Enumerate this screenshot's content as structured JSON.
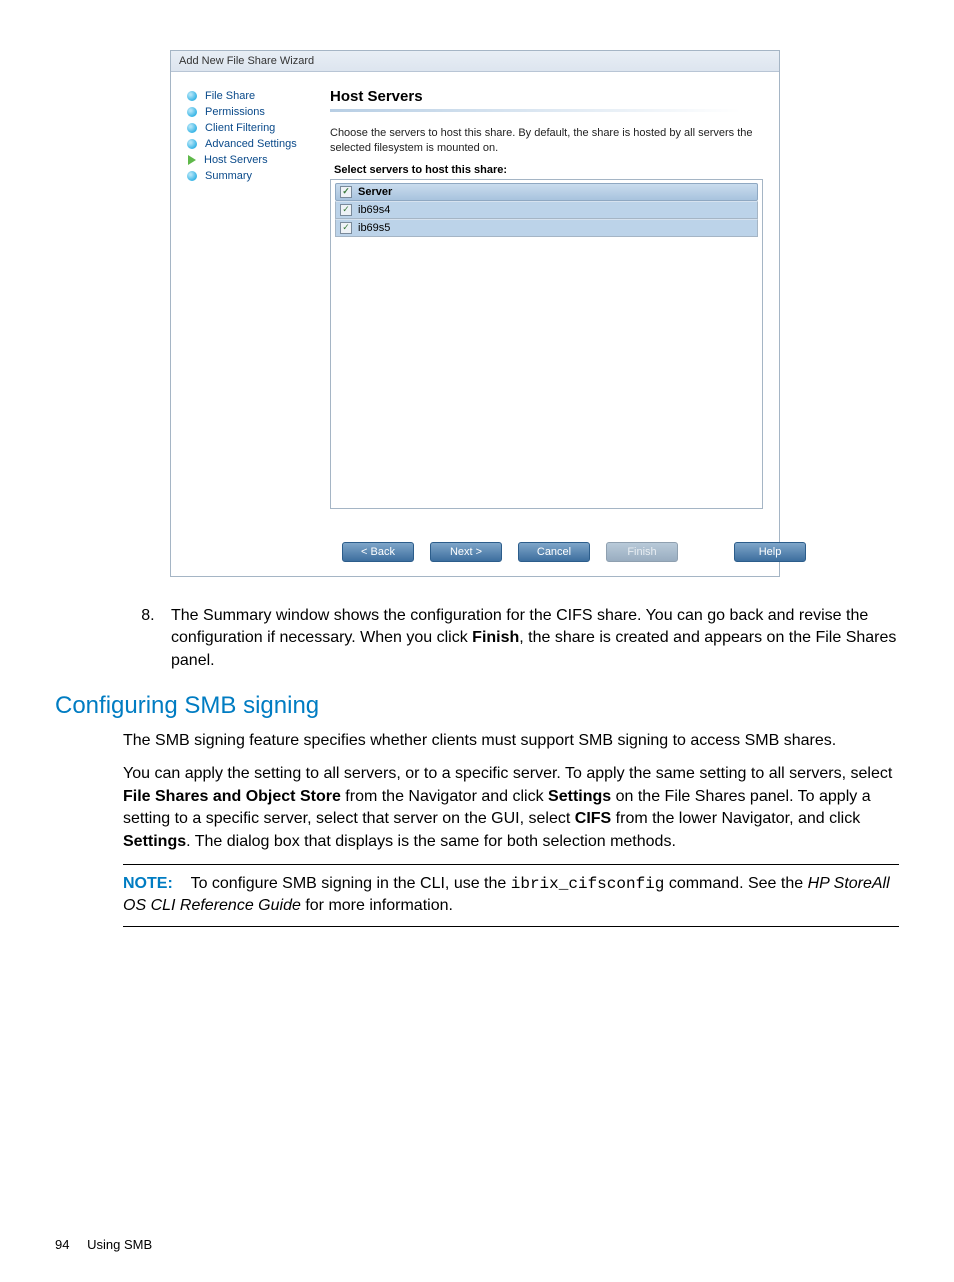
{
  "wizard": {
    "title": "Add New File Share Wizard",
    "nav": [
      {
        "label": "File Share",
        "current": false
      },
      {
        "label": "Permissions",
        "current": false
      },
      {
        "label": "Client Filtering",
        "current": false
      },
      {
        "label": "Advanced Settings",
        "current": false
      },
      {
        "label": "Host Servers",
        "current": true
      },
      {
        "label": "Summary",
        "current": false
      }
    ],
    "content": {
      "heading": "Host Servers",
      "description": "Choose the servers to host this share. By default, the share is hosted by all servers the selected filesystem is mounted on.",
      "select_label": "Select servers to host this share:",
      "server_header": "Server",
      "servers": [
        {
          "name": "ib69s4",
          "checked": true
        },
        {
          "name": "ib69s5",
          "checked": true
        }
      ]
    },
    "buttons": {
      "back": "< Back",
      "next": "Next >",
      "cancel": "Cancel",
      "finish": "Finish",
      "help": "Help"
    }
  },
  "doc": {
    "step8_pre": "The Summary window shows the configuration for the CIFS share. You can go back and revise the configuration if necessary. When you click ",
    "step8_bold": "Finish",
    "step8_post": ", the share is created and appears on the File Shares panel.",
    "section_heading": "Configuring SMB signing",
    "p1": "The SMB signing feature specifies whether clients must support SMB signing to access SMB shares.",
    "p2_a": "You can apply the setting to all servers, or to a specific server. To apply the same setting to all servers, select ",
    "p2_b1": "File Shares and Object Store",
    "p2_c": " from the Navigator and click ",
    "p2_b2": "Settings",
    "p2_d": " on the File Shares panel. To apply a setting to a specific server, select that server on the GUI, select ",
    "p2_b3": "CIFS",
    "p2_e": " from the lower Navigator, and click ",
    "p2_b4": "Settings",
    "p2_f": ". The dialog box that displays is the same for both selection methods.",
    "note_label": "NOTE:",
    "note_pre": "To configure SMB signing in the CLI, use the ",
    "note_cmd": "ibrix_cifsconfig",
    "note_mid": " command. See the ",
    "note_italic": "HP StoreAll OS CLI Reference Guide",
    "note_post": " for more information.",
    "page_number": "94",
    "page_label": "Using SMB"
  }
}
